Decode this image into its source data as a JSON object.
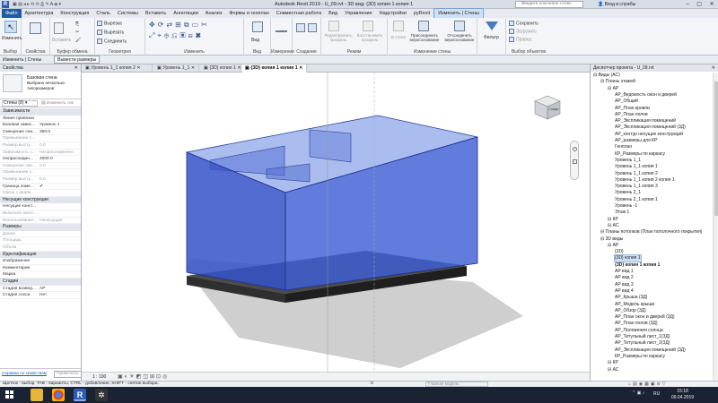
{
  "title_bar": {
    "title": "Autodesk Revit 2019 - U_09.rvt - 3D вид: {3D} копия 1 копия 1",
    "search_placeholder": "Введите ключевое слово",
    "signin": "Вход в службы"
  },
  "menu": [
    "Файл",
    "Архитектура",
    "Конструкция",
    "Сталь",
    "Системы",
    "Вставить",
    "Аннотации",
    "Анализ",
    "Формы и генплан",
    "Совместная работа",
    "Вид",
    "Управление",
    "Надстройки",
    "pyRevit",
    "Изменить | Стены"
  ],
  "ribbon": {
    "modify": "Изменить",
    "select_label": "Выбор",
    "props_label": "Свойства",
    "insert": "Вставить",
    "clipboard_label": "Буфер обмена",
    "cut": "Вырезка",
    "cut2": "Вырезать",
    "join": "Соединить",
    "geometry_label": "Геометрия",
    "modify_label": "Изменить",
    "view": "Вид",
    "view_label": "Вид",
    "measure_label": "Измерение",
    "create_label": "Создание",
    "edit_profile": "Редактировать профиль",
    "reset_profile": "Восстановить профиль",
    "in_wall": "В стене",
    "attach": "Присоединить верх/основание",
    "detach": "Отсоединить верх/основание",
    "mode_label": "Режим",
    "wall_edit_label": "Изменение стены",
    "filter": "Фильтр",
    "save": "Сохранить",
    "load": "Загрузить",
    "edit": "Правка",
    "selection_label": "Выбор объектов"
  },
  "context_bar": {
    "label": "Изменить | Стены",
    "button": "Вывести размеры"
  },
  "tabs": [
    "Уровень 1_1 копия 2",
    "Уровень 1_1",
    "{3D} копия 1",
    "{3D} копия 1 копия 1"
  ],
  "properties": {
    "header": "Свойства",
    "type_name": "Базовая стена",
    "type_sub": "Выбрано несколько типоразмеров",
    "instance_filter": "Стены (8)",
    "edit_type": "Изменить тип",
    "rows": [
      {
        "cat": "Зависимости"
      },
      {
        "k": "Линия привязки",
        "v": ""
      },
      {
        "k": "Базовая завис...",
        "v": "Уровень 1"
      },
      {
        "k": "Смещение сни...",
        "v": "350.0"
      },
      {
        "k": "Примыкание с...",
        "v": "",
        "dim": true
      },
      {
        "k": "Размер высту...",
        "v": "0.0",
        "dim": true
      },
      {
        "k": "Зависимость с...",
        "v": "Неприсоединено",
        "dim": true
      },
      {
        "k": "Неприсоедин...",
        "v": "4000.0"
      },
      {
        "k": "Смещение све...",
        "v": "0.0",
        "dim": true
      },
      {
        "k": "Примыкание с...",
        "v": "",
        "dim": true
      },
      {
        "k": "Размер высту...",
        "v": "0.0",
        "dim": true
      },
      {
        "k": "Граница поме...",
        "v": "✔"
      },
      {
        "k": "Связь с форм...",
        "v": "",
        "dim": true
      },
      {
        "cat": "Несущие конструкции"
      },
      {
        "k": "Несущие конст...",
        "v": ""
      },
      {
        "k": "Включить анал...",
        "v": "",
        "dim": true
      },
      {
        "k": "Использование...",
        "v": "Ненесущая",
        "dim": true
      },
      {
        "cat": "Размеры"
      },
      {
        "k": "Длина",
        "v": "",
        "dim": true
      },
      {
        "k": "Площадь",
        "v": "",
        "dim": true
      },
      {
        "k": "Объем",
        "v": "",
        "dim": true
      },
      {
        "cat": "Идентификация"
      },
      {
        "k": "Изображение",
        "v": ""
      },
      {
        "k": "Комментарии",
        "v": ""
      },
      {
        "k": "Марка",
        "v": ""
      },
      {
        "cat": "Стадии"
      },
      {
        "k": "Стадия возвед...",
        "v": "АР"
      },
      {
        "k": "Стадия сноса",
        "v": "Нет"
      }
    ],
    "help_link": "Справка по свойствам",
    "apply": "Применить"
  },
  "viewport": {
    "scale": "1 : 100",
    "cube_label": "Сзади"
  },
  "browser": {
    "header": "Диспетчер проекта - U_09.rvt",
    "items": [
      {
        "t": "Виды (АС)",
        "lv": 0
      },
      {
        "t": "Планы этажей",
        "lv": 1
      },
      {
        "t": "АР",
        "lv": 2
      },
      {
        "t": "АР_Ведомость окон и дверей",
        "lv": 3
      },
      {
        "t": "АР_Общий",
        "lv": 3
      },
      {
        "t": "АР_План кровли",
        "lv": 3
      },
      {
        "t": "АР_План полов",
        "lv": 3
      },
      {
        "t": "АР_Экспликация помещений",
        "lv": 3
      },
      {
        "t": "АР_Экспликация помещений (3Д)",
        "lv": 3
      },
      {
        "t": "АР_контур несущих конструкций",
        "lv": 3
      },
      {
        "t": "АР_размеры для КР",
        "lv": 3
      },
      {
        "t": "Генплан",
        "lv": 3
      },
      {
        "t": "КР_Размеры по каркасу",
        "lv": 3
      },
      {
        "t": "Уровень 1_1",
        "lv": 3
      },
      {
        "t": "Уровень 1_1 копия 1",
        "lv": 3
      },
      {
        "t": "Уровень 1_1 копия 2",
        "lv": 3
      },
      {
        "t": "Уровень 1_1 копия 2 копия 1",
        "lv": 3
      },
      {
        "t": "Уровень 1_1 копия 3",
        "lv": 3
      },
      {
        "t": "Уровень 2_1",
        "lv": 3
      },
      {
        "t": "Уровень 2_1 копия 1",
        "lv": 3
      },
      {
        "t": "Уровень -1",
        "lv": 3
      },
      {
        "t": "Этаж 1",
        "lv": 3
      },
      {
        "t": "КР",
        "lv": 2
      },
      {
        "t": "АС",
        "lv": 2
      },
      {
        "t": "Планы потолков (План потолочного покрытия)",
        "lv": 1
      },
      {
        "t": "3D виды",
        "lv": 1
      },
      {
        "t": "АР",
        "lv": 2
      },
      {
        "t": "{3D}",
        "lv": 3
      },
      {
        "t": "{3D} копия 1",
        "lv": 3,
        "sel": true
      },
      {
        "t": "{3D} копия 1 копия 1",
        "lv": 3,
        "bold": true
      },
      {
        "t": "АР вид 1",
        "lv": 3
      },
      {
        "t": "АР вид 2",
        "lv": 3
      },
      {
        "t": "АР вид 3",
        "lv": 3
      },
      {
        "t": "АР вид 4",
        "lv": 3
      },
      {
        "t": "АР_Крыша (3Д)",
        "lv": 3
      },
      {
        "t": "АР_Модель крыши",
        "lv": 3
      },
      {
        "t": "АР_Обзор (3Д)",
        "lv": 3
      },
      {
        "t": "АР_План окон и дверей (3Д)",
        "lv": 3
      },
      {
        "t": "АР_План полов (3Д)",
        "lv": 3
      },
      {
        "t": "АР_Положения солнца",
        "lv": 3
      },
      {
        "t": "АР_Титульный лист_1(3Д)",
        "lv": 3
      },
      {
        "t": "АР_Титульный лист_2(3Д)",
        "lv": 3
      },
      {
        "t": "АР_Экспликация помещений (3Д)",
        "lv": 3
      },
      {
        "t": "КР_Размеры по каркасу",
        "lv": 3
      },
      {
        "t": "КР",
        "lv": 2
      },
      {
        "t": "АС",
        "lv": 2
      }
    ]
  },
  "status": {
    "hint": "Щелчок - выбор, TAB - варианты, CTRL - добавление, SHIFT - снятие выбора.",
    "model": "Главная модель",
    "zero": ":0"
  },
  "taskbar": {
    "time": "15:18",
    "date": "09.04.2019",
    "lang": "RU"
  },
  "colors": {
    "wall": "#3d5fd0",
    "accent": "#1e5aa8"
  }
}
